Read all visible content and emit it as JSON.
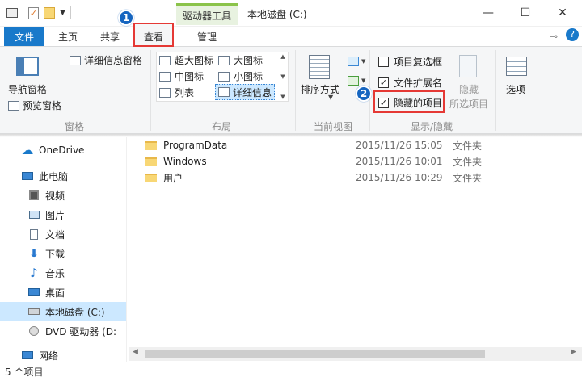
{
  "titlebar": {
    "context_tab": "驱动器工具",
    "title": "本地磁盘 (C:)",
    "min": "—",
    "max": "☐",
    "close": "✕"
  },
  "tabs": {
    "file": "文件",
    "home": "主页",
    "share": "共享",
    "view": "查看",
    "manage": "管理"
  },
  "badges": {
    "one": "1",
    "two": "2"
  },
  "ribbon": {
    "panes": {
      "nav_pane": "导航窗格",
      "preview_pane": "预览窗格",
      "details_pane": "详细信息窗格",
      "label": "窗格"
    },
    "layout": {
      "extra_large": "超大图标",
      "large": "大图标",
      "medium": "中图标",
      "small": "小图标",
      "list": "列表",
      "details": "详细信息",
      "label": "布局"
    },
    "current_view": {
      "sort_by": "排序方式",
      "label": "当前视图"
    },
    "show_hide": {
      "item_checkboxes": "项目复选框",
      "file_extensions": "文件扩展名",
      "hidden_items": "隐藏的项目",
      "hide": "隐藏",
      "selected_items": "所选项目",
      "label": "显示/隐藏",
      "item_checkboxes_checked": false,
      "file_extensions_checked": true,
      "hidden_items_checked": true
    },
    "options": "选项"
  },
  "nav": {
    "items": [
      {
        "label": "OneDrive",
        "icon": "cloud-icon"
      },
      {
        "label": "此电脑",
        "icon": "computer-icon"
      },
      {
        "label": "视频",
        "icon": "video-icon"
      },
      {
        "label": "图片",
        "icon": "picture-icon"
      },
      {
        "label": "文档",
        "icon": "document-icon"
      },
      {
        "label": "下载",
        "icon": "download-icon"
      },
      {
        "label": "音乐",
        "icon": "music-icon"
      },
      {
        "label": "桌面",
        "icon": "desktop-icon"
      },
      {
        "label": "本地磁盘 (C:)",
        "icon": "drive-icon"
      },
      {
        "label": "DVD 驱动器 (D:",
        "icon": "dvd-icon"
      },
      {
        "label": "网络",
        "icon": "network-icon"
      }
    ]
  },
  "files": [
    {
      "name": "ProgramData",
      "date": "2015/11/26 15:05",
      "type": "文件夹"
    },
    {
      "name": "Windows",
      "date": "2015/11/26 10:01",
      "type": "文件夹"
    },
    {
      "name": "用户",
      "date": "2015/11/26 10:29",
      "type": "文件夹"
    }
  ],
  "status": "5 个项目",
  "colors": {
    "accent": "#1979ca",
    "highlight": "#e53935",
    "selected": "#cce8ff"
  }
}
